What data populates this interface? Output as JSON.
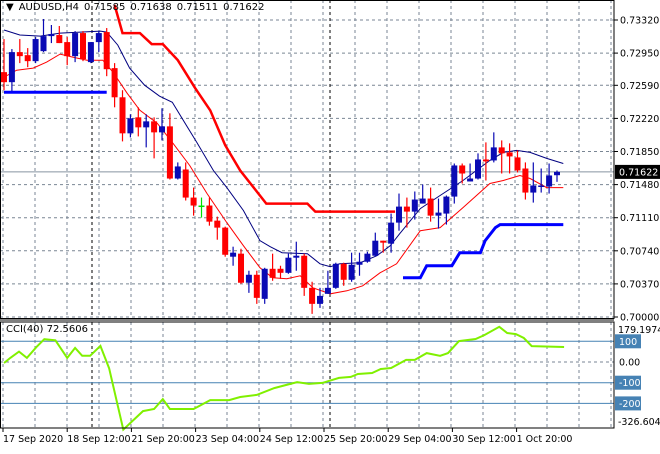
{
  "header": {
    "symbol_timeframe": "AUDUSD,H4",
    "open": "0.71585",
    "high": "0.71638",
    "low": "0.71511",
    "close": "0.71622"
  },
  "cci_panel": {
    "label": "CCI(40) 72.5606",
    "scale_max": "179.1974",
    "scale_min": "-326.6041",
    "levels": [
      "100",
      "0.00",
      "-100",
      "-200"
    ]
  },
  "colors": {
    "bull": "#0A0AB4",
    "bear": "#FF0000",
    "doji": "#00E000",
    "ma_fast": "#FF0000",
    "ma_slow": "#000080",
    "stop_upper": "#FF0000",
    "stop_lower": "#0000FF",
    "cci": "#80F000",
    "level": "#4682B4",
    "grid": "#7A8694"
  },
  "chart_data": [
    {
      "type": "candlestick",
      "title": "AUDUSD,H4",
      "y_ticks": [
        "0.73320",
        "0.72950",
        "0.72590",
        "0.72220",
        "0.71850",
        "0.71480",
        "0.71110",
        "0.70740",
        "0.70370",
        "0.70000"
      ],
      "ylim": [
        0.7,
        0.7332
      ],
      "current_price": "0.71622",
      "x_tick_labels": [
        "17 Sep 2020",
        "18 Sep 12:00",
        "21 Sep 20:00",
        "23 Sep 04:00",
        "24 Sep 12:00",
        "25 Sep 20:00",
        "29 Sep 04:00",
        "30 Sep 12:00",
        "1 Oct 20:00"
      ],
      "ohlc": [
        [
          0.72737,
          0.73107,
          0.72535,
          0.72625
        ],
        [
          0.72625,
          0.72995,
          0.72524,
          0.72961
        ],
        [
          0.72961,
          0.73107,
          0.72838,
          0.72916
        ],
        [
          0.72927,
          0.73006,
          0.72793,
          0.7286
        ],
        [
          0.7286,
          0.73129,
          0.72838,
          0.73107
        ],
        [
          0.72972,
          0.73331,
          0.72961,
          0.7314
        ],
        [
          0.7314,
          0.73264,
          0.73062,
          0.73163
        ],
        [
          0.73152,
          0.73253,
          0.73062,
          0.73062
        ],
        [
          0.73073,
          0.73129,
          0.72815,
          0.72916
        ],
        [
          0.72916,
          0.73196,
          0.72849,
          0.73174
        ],
        [
          0.73174,
          0.73196,
          0.7286,
          0.72882
        ],
        [
          0.72849,
          0.73073,
          0.72838,
          0.73073
        ],
        [
          0.73073,
          0.73196,
          0.72961,
          0.73174
        ],
        [
          0.73185,
          0.7323,
          0.72692,
          0.7277
        ],
        [
          0.72782,
          0.72838,
          0.72344,
          0.72456
        ],
        [
          0.72456,
          0.72535,
          0.71963,
          0.72053
        ],
        [
          0.72053,
          0.72266,
          0.72008,
          0.72221
        ],
        [
          0.72232,
          0.72344,
          0.72019,
          0.7212
        ],
        [
          0.7212,
          0.72266,
          0.71896,
          0.72187
        ],
        [
          0.72187,
          0.72232,
          0.71773,
          0.72064
        ],
        [
          0.72064,
          0.72333,
          0.71974,
          0.72131
        ],
        [
          0.72131,
          0.72277,
          0.71537,
          0.71548
        ],
        [
          0.71548,
          0.71728,
          0.71537,
          0.71683
        ],
        [
          0.71649,
          0.71728,
          0.71302,
          0.71335
        ],
        [
          0.71335,
          0.71447,
          0.71133,
          0.71246
        ],
        [
          0.71246,
          0.71335,
          0.71111,
          0.71246
        ],
        [
          0.71246,
          0.71335,
          0.71021,
          0.71066
        ],
        [
          0.71077,
          0.71122,
          0.70864,
          0.70999
        ],
        [
          0.70999,
          0.7101,
          0.70674,
          0.70696
        ],
        [
          0.70674,
          0.70786,
          0.70573,
          0.70719
        ],
        [
          0.70708,
          0.70763,
          0.70371,
          0.70383
        ],
        [
          0.70383,
          0.70517,
          0.7027,
          0.70472
        ],
        [
          0.70472,
          0.70517,
          0.70147,
          0.70214
        ],
        [
          0.70203,
          0.7055,
          0.70147,
          0.70539
        ],
        [
          0.70539,
          0.70708,
          0.70405,
          0.70438
        ],
        [
          0.70539,
          0.70573,
          0.70427,
          0.70494
        ],
        [
          0.70494,
          0.70708,
          0.70483,
          0.70663
        ],
        [
          0.70663,
          0.70842,
          0.70517,
          0.70685
        ],
        [
          0.70685,
          0.70708,
          0.70236,
          0.70326
        ],
        [
          0.70326,
          0.70394,
          0.70035,
          0.70147
        ],
        [
          0.70147,
          0.70326,
          0.70102,
          0.70236
        ],
        [
          0.70259,
          0.70517,
          0.70259,
          0.70326
        ],
        [
          0.70326,
          0.70607,
          0.70315,
          0.70595
        ],
        [
          0.70595,
          0.70607,
          0.70349,
          0.70416
        ],
        [
          0.70416,
          0.70719,
          0.70394,
          0.70584
        ],
        [
          0.70584,
          0.70719,
          0.70461,
          0.70618
        ],
        [
          0.70618,
          0.7073,
          0.70607,
          0.70708
        ],
        [
          0.70685,
          0.70943,
          0.70674,
          0.70853
        ],
        [
          0.70853,
          0.70853,
          0.70719,
          0.70831
        ],
        [
          0.7082,
          0.71156,
          0.70719,
          0.71055
        ],
        [
          0.71055,
          0.7138,
          0.70965,
          0.71234
        ],
        [
          0.71234,
          0.71335,
          0.70999,
          0.71178
        ],
        [
          0.71178,
          0.71403,
          0.71089,
          0.71313
        ],
        [
          0.71268,
          0.71481,
          0.71268,
          0.71324
        ],
        [
          0.71324,
          0.71447,
          0.71066,
          0.71133
        ],
        [
          0.71133,
          0.71324,
          0.70988,
          0.71167
        ],
        [
          0.71156,
          0.71358,
          0.71033,
          0.71346
        ],
        [
          0.71346,
          0.71716,
          0.71268,
          0.71694
        ],
        [
          0.71694,
          0.71716,
          0.71492,
          0.71604
        ],
        [
          0.71515,
          0.71716,
          0.71515,
          0.71548
        ],
        [
          0.71548,
          0.71829,
          0.71537,
          0.71761
        ],
        [
          0.71761,
          0.71952,
          0.71526,
          0.71739
        ],
        [
          0.7175,
          0.72064,
          0.71728,
          0.71896
        ],
        [
          0.71896,
          0.71974,
          0.71604,
          0.71829
        ],
        [
          0.7184,
          0.71941,
          0.71604,
          0.71795
        ],
        [
          0.71784,
          0.71862,
          0.71616,
          0.71638
        ],
        [
          0.7166,
          0.71728,
          0.71313,
          0.71391
        ],
        [
          0.71391,
          0.71728,
          0.71279,
          0.7147
        ],
        [
          0.71459,
          0.7166,
          0.71391,
          0.7147
        ],
        [
          0.71459,
          0.71716,
          0.7138,
          0.71582
        ],
        [
          0.71585,
          0.71638,
          0.71511,
          0.71622
        ]
      ],
      "ma_slow": [
        [
          0,
          0.73208
        ],
        [
          2,
          0.73152
        ],
        [
          4.6,
          0.7314
        ],
        [
          7.1,
          0.73174
        ],
        [
          12.2,
          0.73196
        ],
        [
          13,
          0.73185
        ],
        [
          14.4,
          0.73039
        ],
        [
          15.9,
          0.72782
        ],
        [
          17.8,
          0.72591
        ],
        [
          19.7,
          0.72468
        ],
        [
          21.3,
          0.724
        ],
        [
          22.3,
          0.72255
        ],
        [
          24.4,
          0.71952
        ],
        [
          26.5,
          0.71638
        ],
        [
          28.2,
          0.71447
        ],
        [
          30.3,
          0.7119
        ],
        [
          32.4,
          0.70853
        ],
        [
          33.7,
          0.70786
        ],
        [
          35.2,
          0.70719
        ],
        [
          38.4,
          0.70708
        ],
        [
          40,
          0.70595
        ],
        [
          41.3,
          0.70562
        ],
        [
          42.5,
          0.70595
        ],
        [
          45.1,
          0.70607
        ],
        [
          47.2,
          0.70685
        ],
        [
          48.9,
          0.70797
        ],
        [
          50.1,
          0.70932
        ],
        [
          52.7,
          0.71212
        ],
        [
          55.2,
          0.71358
        ],
        [
          58.1,
          0.71526
        ],
        [
          61.5,
          0.7175
        ],
        [
          63.2,
          0.7184
        ],
        [
          64.9,
          0.71862
        ],
        [
          66.6,
          0.7184
        ],
        [
          68.7,
          0.71773
        ],
        [
          70.8,
          0.71716
        ]
      ],
      "ma_fast": [
        [
          0,
          0.72681
        ],
        [
          1.6,
          0.72759
        ],
        [
          3.7,
          0.72782
        ],
        [
          5.4,
          0.72849
        ],
        [
          7.1,
          0.72939
        ],
        [
          8.7,
          0.72905
        ],
        [
          10.5,
          0.72871
        ],
        [
          12.5,
          0.72871
        ],
        [
          13.8,
          0.72737
        ],
        [
          15.6,
          0.72501
        ],
        [
          17.2,
          0.72311
        ],
        [
          19.4,
          0.72165
        ],
        [
          21.4,
          0.71941
        ],
        [
          23.5,
          0.71694
        ],
        [
          25.7,
          0.7138
        ],
        [
          28.2,
          0.71055
        ],
        [
          30.3,
          0.70797
        ],
        [
          32.4,
          0.7055
        ],
        [
          34,
          0.70438
        ],
        [
          35.8,
          0.70427
        ],
        [
          37.5,
          0.70461
        ],
        [
          39.1,
          0.70326
        ],
        [
          41.3,
          0.70259
        ],
        [
          43.4,
          0.70293
        ],
        [
          45.4,
          0.70349
        ],
        [
          47.6,
          0.70494
        ],
        [
          49.7,
          0.70595
        ],
        [
          52.7,
          0.70965
        ],
        [
          55.2,
          0.70999
        ],
        [
          58.1,
          0.71223
        ],
        [
          61.5,
          0.71492
        ],
        [
          63.2,
          0.71526
        ],
        [
          65.3,
          0.71582
        ],
        [
          66.6,
          0.71548
        ],
        [
          68.7,
          0.71447
        ],
        [
          70.8,
          0.71447
        ]
      ],
      "stop_upper": [
        [
          [
            14,
            0.73488
          ],
          [
            15,
            0.73174
          ],
          [
            17.2,
            0.73174
          ],
          [
            18.7,
            0.73051
          ],
          [
            20.1,
            0.73051
          ],
          [
            22,
            0.72871
          ],
          [
            24.2,
            0.72558
          ],
          [
            26.1,
            0.72311
          ],
          [
            28,
            0.71921
          ],
          [
            29.9,
            0.71638
          ],
          [
            33.2,
            0.71268
          ],
          [
            38.4,
            0.71268
          ],
          [
            39.4,
            0.71178
          ],
          [
            49.5,
            0.71178
          ]
        ]
      ],
      "stop_lower": [
        [
          [
            0,
            0.72513
          ],
          [
            13,
            0.72513
          ]
        ],
        [
          [
            50.5,
            0.70438
          ],
          [
            52.7,
            0.70438
          ],
          [
            53.5,
            0.70573
          ],
          [
            56.7,
            0.70573
          ],
          [
            57.7,
            0.70719
          ],
          [
            60.3,
            0.70719
          ],
          [
            60.9,
            0.70853
          ],
          [
            62.2,
            0.70999
          ],
          [
            62.8,
            0.71033
          ],
          [
            70.8,
            0.71033
          ]
        ]
      ]
    },
    {
      "type": "line",
      "title": "CCI(40)",
      "ylim": [
        -326.6041,
        179.1974
      ],
      "levels": [
        100,
        -100,
        -200
      ],
      "series": [
        {
          "name": "CCI(40)",
          "points": [
            [
              0,
              -5
            ],
            [
              0.8,
              20
            ],
            [
              1.9,
              50
            ],
            [
              2.9,
              20
            ],
            [
              4.1,
              72
            ],
            [
              5.1,
              110
            ],
            [
              6.5,
              105
            ],
            [
              8,
              20
            ],
            [
              9,
              68
            ],
            [
              9.9,
              30
            ],
            [
              10.9,
              30
            ],
            [
              12.2,
              78
            ],
            [
              13.3,
              -30
            ],
            [
              15.1,
              -326.6
            ],
            [
              17.6,
              -237
            ],
            [
              19,
              -227
            ],
            [
              20.1,
              -179
            ],
            [
              21,
              -227
            ],
            [
              24,
              -227
            ],
            [
              26.1,
              -184
            ],
            [
              28.5,
              -184
            ],
            [
              29.9,
              -169
            ],
            [
              32,
              -159
            ],
            [
              34.2,
              -126
            ],
            [
              35.7,
              -111
            ],
            [
              37.1,
              -97
            ],
            [
              38.6,
              -106
            ],
            [
              40.3,
              -101
            ],
            [
              42.4,
              -77
            ],
            [
              43.9,
              -72
            ],
            [
              44.8,
              -58
            ],
            [
              46.6,
              -53
            ],
            [
              47.7,
              -34
            ],
            [
              49,
              -29
            ],
            [
              50.9,
              10
            ],
            [
              52,
              10
            ],
            [
              53.5,
              43
            ],
            [
              55.2,
              30
            ],
            [
              56.2,
              43
            ],
            [
              57.6,
              101
            ],
            [
              59.7,
              111
            ],
            [
              60.8,
              130
            ],
            [
              62.7,
              170
            ],
            [
              63.7,
              140
            ],
            [
              64.8,
              135
            ],
            [
              65.8,
              116
            ],
            [
              66.8,
              77
            ],
            [
              70.9,
              72.56
            ]
          ]
        }
      ]
    }
  ]
}
